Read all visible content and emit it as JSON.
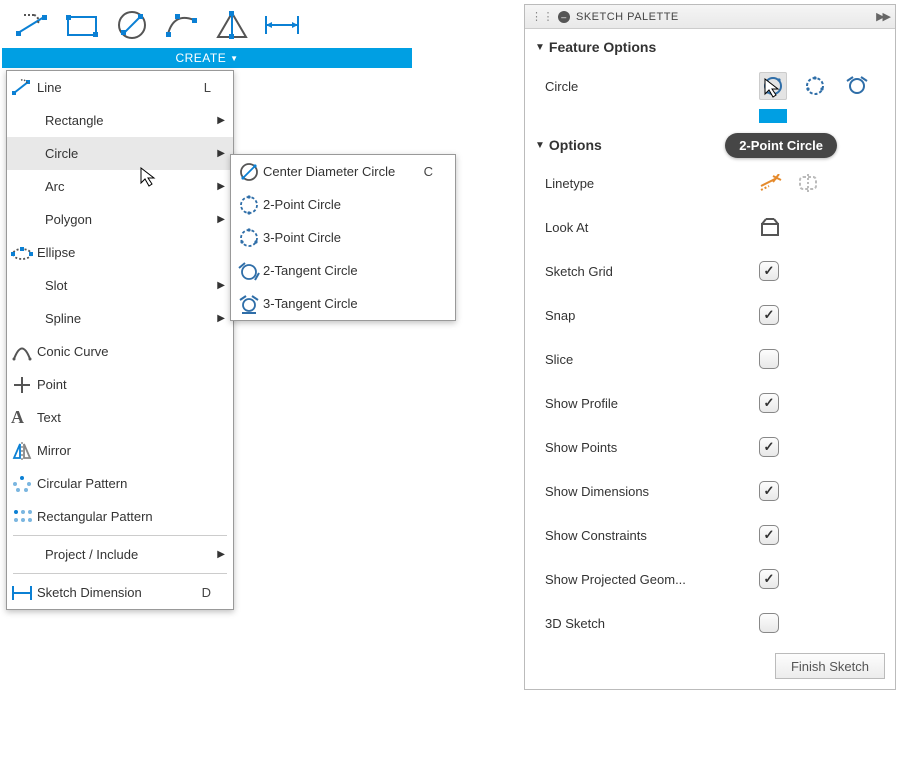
{
  "toolbar": {
    "create_label": "CREATE"
  },
  "menu": {
    "items": [
      {
        "label": "Line",
        "shortcut": "L",
        "icon": "line"
      },
      {
        "label": "Rectangle",
        "submenu": true,
        "indent": true
      },
      {
        "label": "Circle",
        "submenu": true,
        "indent": true,
        "hover": true
      },
      {
        "label": "Arc",
        "submenu": true,
        "indent": true
      },
      {
        "label": "Polygon",
        "submenu": true,
        "indent": true
      },
      {
        "label": "Ellipse",
        "icon": "ellipse"
      },
      {
        "label": "Slot",
        "submenu": true,
        "indent": true
      },
      {
        "label": "Spline",
        "submenu": true,
        "indent": true
      },
      {
        "label": "Conic Curve",
        "icon": "conic"
      },
      {
        "label": "Point",
        "icon": "point"
      },
      {
        "label": "Text",
        "icon": "text"
      },
      {
        "label": "Mirror",
        "icon": "mirror"
      },
      {
        "label": "Circular Pattern",
        "icon": "circpattern"
      },
      {
        "label": "Rectangular Pattern",
        "icon": "rectpattern"
      },
      {
        "label": "Project / Include",
        "submenu": true,
        "indent": true
      },
      {
        "label": "Sketch Dimension",
        "shortcut": "D",
        "icon": "dimension"
      }
    ]
  },
  "submenu": {
    "items": [
      {
        "label": "Center Diameter Circle",
        "shortcut": "C",
        "icon": "c-diam"
      },
      {
        "label": "2-Point Circle",
        "icon": "c-2pt"
      },
      {
        "label": "3-Point Circle",
        "icon": "c-3pt"
      },
      {
        "label": "2-Tangent Circle",
        "icon": "c-2tan"
      },
      {
        "label": "3-Tangent Circle",
        "icon": "c-3tan"
      }
    ]
  },
  "palette": {
    "title": "SKETCH PALETTE",
    "sections": {
      "feature": "Feature Options",
      "options": "Options"
    },
    "feature_row_label": "Circle",
    "tooltip": "2-Point Circle",
    "option_rows": [
      {
        "label": "Linetype",
        "type": "linetype"
      },
      {
        "label": "Look At",
        "type": "lookat"
      },
      {
        "label": "Sketch Grid",
        "type": "check",
        "checked": true
      },
      {
        "label": "Snap",
        "type": "check",
        "checked": true
      },
      {
        "label": "Slice",
        "type": "check",
        "checked": false
      },
      {
        "label": "Show Profile",
        "type": "check",
        "checked": true
      },
      {
        "label": "Show Points",
        "type": "check",
        "checked": true
      },
      {
        "label": "Show Dimensions",
        "type": "check",
        "checked": true
      },
      {
        "label": "Show Constraints",
        "type": "check",
        "checked": true
      },
      {
        "label": "Show Projected Geom...",
        "type": "check",
        "checked": true
      },
      {
        "label": "3D Sketch",
        "type": "check",
        "checked": false
      }
    ],
    "finish_label": "Finish Sketch"
  }
}
